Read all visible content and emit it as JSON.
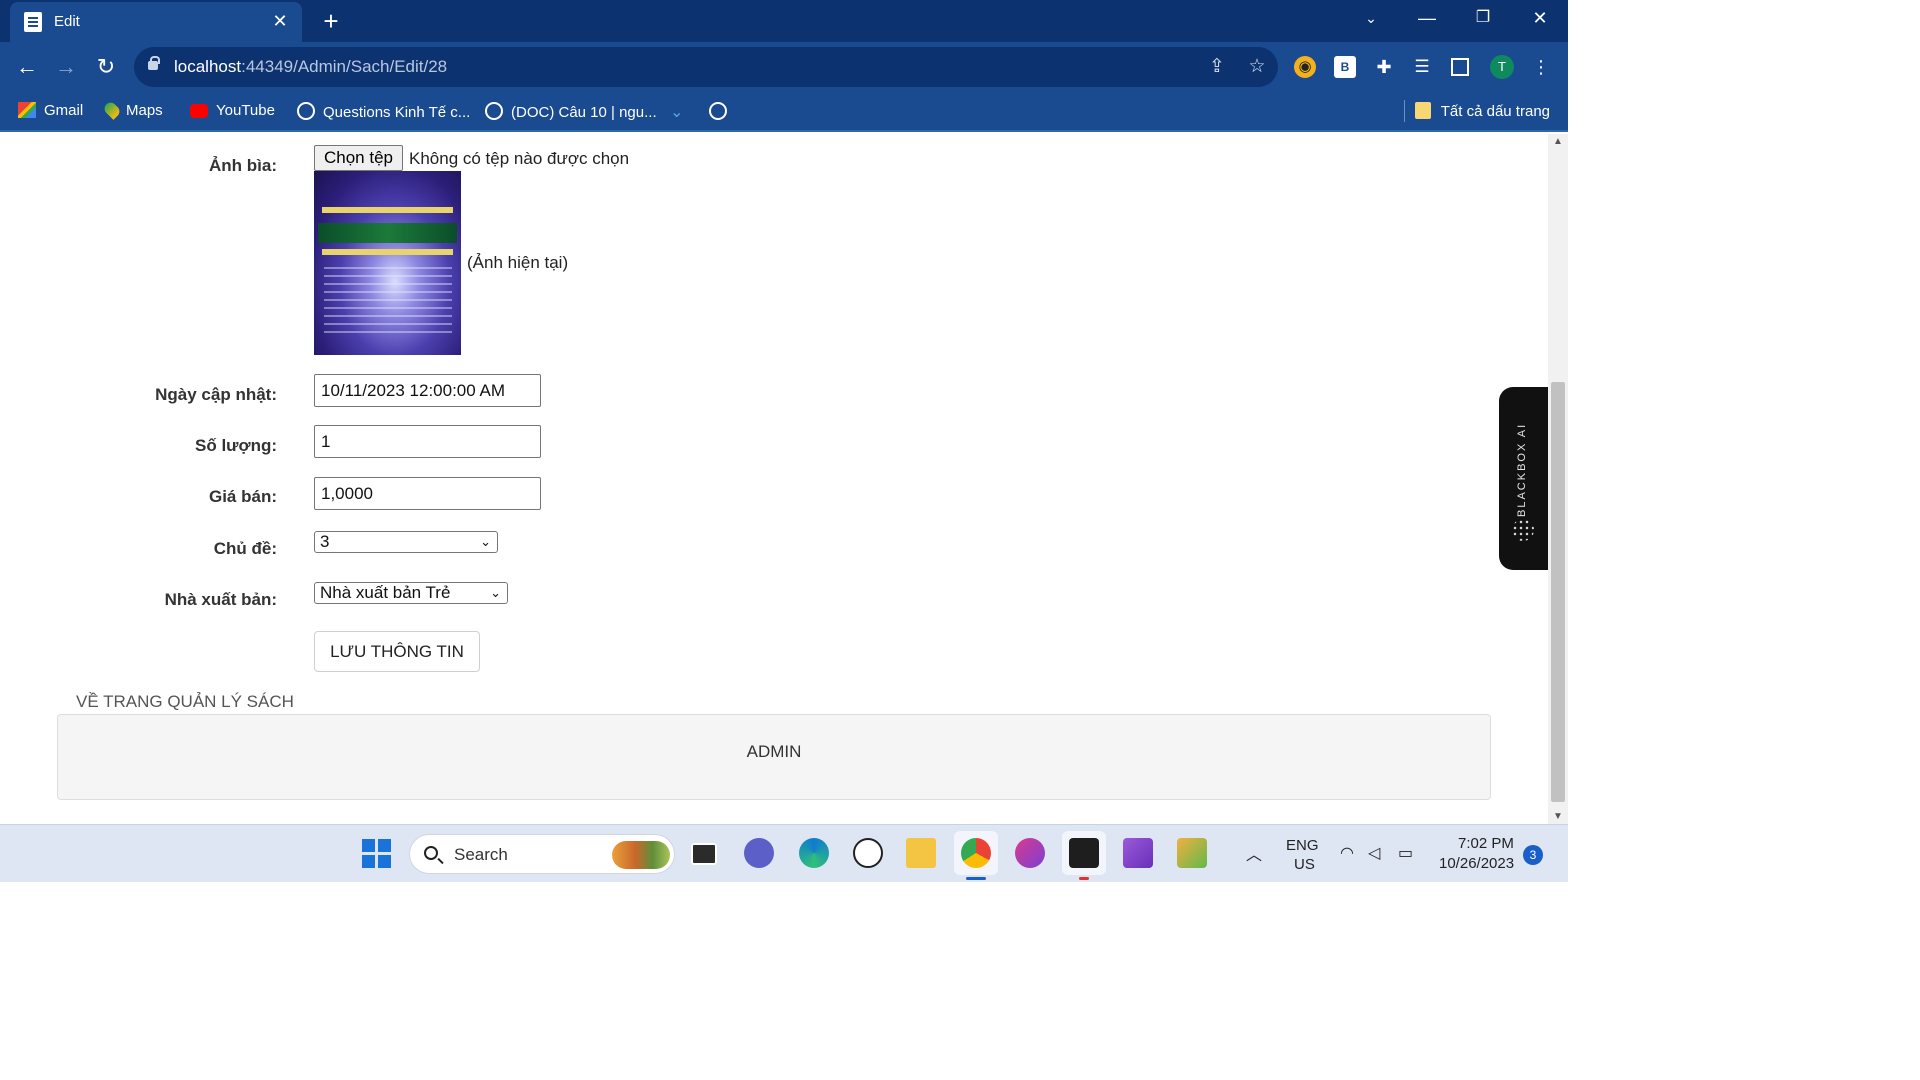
{
  "browser": {
    "tab_title": "Edit",
    "tab_close": "✕",
    "new_tab": "+",
    "url_host": "localhost",
    "url_path": ":44349/Admin/Sach/Edit/28",
    "avatar_initial": "T",
    "extension_b_label": "B"
  },
  "bookmarks": [
    {
      "label": "Gmail",
      "icon": "gmail-icon"
    },
    {
      "label": "Maps",
      "icon": "maps-icon"
    },
    {
      "label": "YouTube",
      "icon": "youtube-icon"
    },
    {
      "label": "Questions Kinh Tế c...",
      "icon": "globe-icon"
    },
    {
      "label": "(DOC) Câu 10 | ngu...",
      "icon": "globe-icon"
    }
  ],
  "bookmarks_all": "Tất cả dấu trang",
  "form": {
    "cover_label": "Ảnh bìa:",
    "file_button": "Chọn tệp",
    "file_status": "Không có tệp nào được chọn",
    "cover_caption": "(Ảnh hiện tại)",
    "updated_label": "Ngày cập nhật:",
    "updated_value": "10/11/2023 12:00:00 AM",
    "quantity_label": "Số lượng:",
    "quantity_value": "1",
    "price_label": "Giá bán:",
    "price_value": "1,0000",
    "topic_label": "Chủ đề:",
    "topic_value": "3",
    "publisher_label": "Nhà xuất bản:",
    "publisher_value": "Nhà xuất bản Trẻ",
    "save_button": "LƯU THÔNG TIN"
  },
  "back_link": "VỀ TRANG QUẢN LÝ SÁCH",
  "footer_text": "ADMIN",
  "side_panel": "BLACKBOX AI",
  "taskbar": {
    "search_placeholder": "Search",
    "lang_top": "ENG",
    "lang_bottom": "US",
    "time": "7:02 PM",
    "date": "10/26/2023",
    "notifications": "3"
  },
  "colors": {
    "tab_strip": "#0d3270",
    "toolbar": "#1a4a8f",
    "taskbar": "#dfe6f3"
  }
}
